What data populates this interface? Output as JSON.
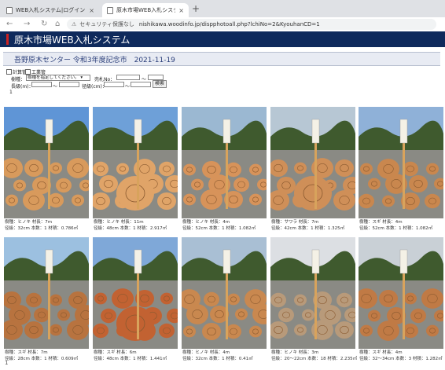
{
  "browser": {
    "tabs": [
      {
        "title": "WEB入札システム|ログイン",
        "close": "×"
      },
      {
        "title": "原木市場WEB入札システム写真一",
        "close": "×"
      }
    ],
    "new_tab": "+",
    "security_label": "セキュリティ保護なし",
    "url": "nishikawa.woodinfo.jp/dispphotoall.php?lchiNo=2&KyouhanCD=1"
  },
  "header": {
    "title": "原木市場WEB入札システム"
  },
  "subheader": {
    "text": "吾野原木センター 令和3年度記念市　2021-11-19"
  },
  "filters": {
    "checkbox_1": "計算管",
    "checkbox_2": "工業管",
    "species_label": "樹種：",
    "species_value": "樹種を指定してください。",
    "lot_label": "売札No：",
    "length_label": "長級(m)：",
    "diameter_label": "径級(cm)：",
    "range_sep_1": "～",
    "range_sep_2": "～",
    "range_sep_3": "～",
    "search_button": "検索"
  },
  "result_count": "1",
  "photos": [
    {
      "line1": "樹種：ヒノキ 材長：7m",
      "line2": "径級：32cm 本数：1 材積：0.786㎥"
    },
    {
      "line1": "樹種：ヒノキ 材長：11m",
      "line2": "径級：48cm 本数：1 材積：2.917㎥"
    },
    {
      "line1": "樹種：ヒノキ 材長：4m",
      "line2": "径級：52cm 本数：1 材積：1.082㎥"
    },
    {
      "line1": "樹種：サワラ 材長：7m",
      "line2": "径級：42cm 本数：1 材積：1.325㎥"
    },
    {
      "line1": "樹種：スギ 材長：4m",
      "line2": "径級：52cm 本数：1 材積：1.082㎥"
    },
    {
      "line1": "樹種：スギ 材長：7m",
      "line2": "径級：28cm 本数：1 材積：0.609㎥"
    },
    {
      "line1": "樹種：スギ 材長：6m",
      "line2": "径級：48cm 本数：1 材積：1.441㎥"
    },
    {
      "line1": "樹種：ヒノキ 材長：4m",
      "line2": "径級：32cm 本数：1 材積：0.41㎥"
    },
    {
      "line1": "樹種：ヒノキ 材長：3m",
      "line2": "径級：20～22cm 本数：18 材積：2.235㎥"
    },
    {
      "line1": "樹種：スギ 材長：4m",
      "line2": "径級：32～34cm 本数：3 材積：1.282㎥"
    }
  ],
  "footer": "1"
}
